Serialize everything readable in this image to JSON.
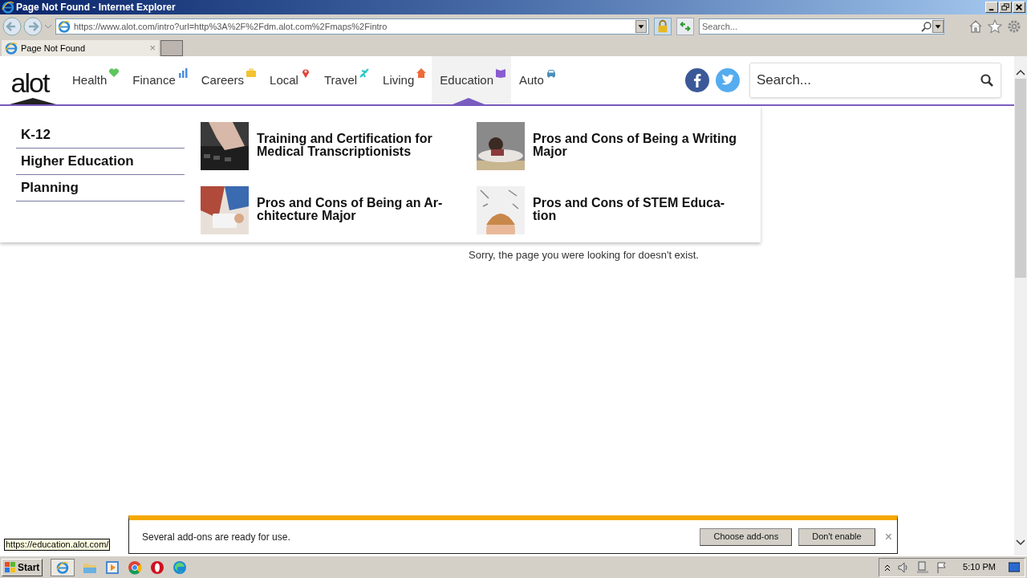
{
  "window": {
    "title": "Page Not Found - Internet Explorer"
  },
  "address_bar": {
    "value": "https://www.alot.com/intro?url=http%3A%2F%2Fdm.alot.com%2Fmaps%2Fintro"
  },
  "browser_search": {
    "placeholder": "Search..."
  },
  "tabs": [
    {
      "label": "Page Not Found",
      "close": "×",
      "selected": true
    }
  ],
  "site": {
    "logo": "alot",
    "nav": [
      {
        "label": "Health",
        "kind": "heart",
        "color": "#5cc75c",
        "selected": false
      },
      {
        "label": "Finance",
        "kind": "bars",
        "color": "#4a8fe0",
        "selected": false
      },
      {
        "label": "Careers",
        "kind": "briefcase",
        "color": "#f2c230",
        "selected": false
      },
      {
        "label": "Local",
        "kind": "pin",
        "color": "#e0453a",
        "selected": false
      },
      {
        "label": "Travel",
        "kind": "plane",
        "color": "#26c6c6",
        "selected": false
      },
      {
        "label": "Living",
        "kind": "house",
        "color": "#f06a3a",
        "selected": false
      },
      {
        "label": "Education",
        "kind": "book",
        "color": "#8a5cd0",
        "selected": true
      },
      {
        "label": "Auto",
        "kind": "car",
        "color": "#4a8fb8",
        "selected": false
      }
    ],
    "search": {
      "placeholder": "Search..."
    },
    "menu": {
      "links": [
        "K-12",
        "Higher Education",
        "Planning"
      ],
      "articles": [
        {
          "lines": [
            "Training and Certification for",
            "Medical Transcriptionists"
          ]
        },
        {
          "lines": [
            "Pros and Cons of Being a Writing",
            "Major"
          ]
        },
        {
          "lines": [
            "Pros and Cons of Being an Ar-",
            "chitecture Major"
          ]
        },
        {
          "lines": [
            "Pros and Cons of STEM Educa-",
            "tion"
          ]
        }
      ]
    },
    "message": "Sorry, the page you were looking for doesn't exist."
  },
  "notification": {
    "message": "Several add-ons are ready for use.",
    "buttons": [
      "Choose add-ons",
      "Don't enable"
    ],
    "close": "×"
  },
  "status_url": "https://education.alot.com/",
  "taskbar": {
    "start": "Start",
    "time": "5:10 PM"
  }
}
